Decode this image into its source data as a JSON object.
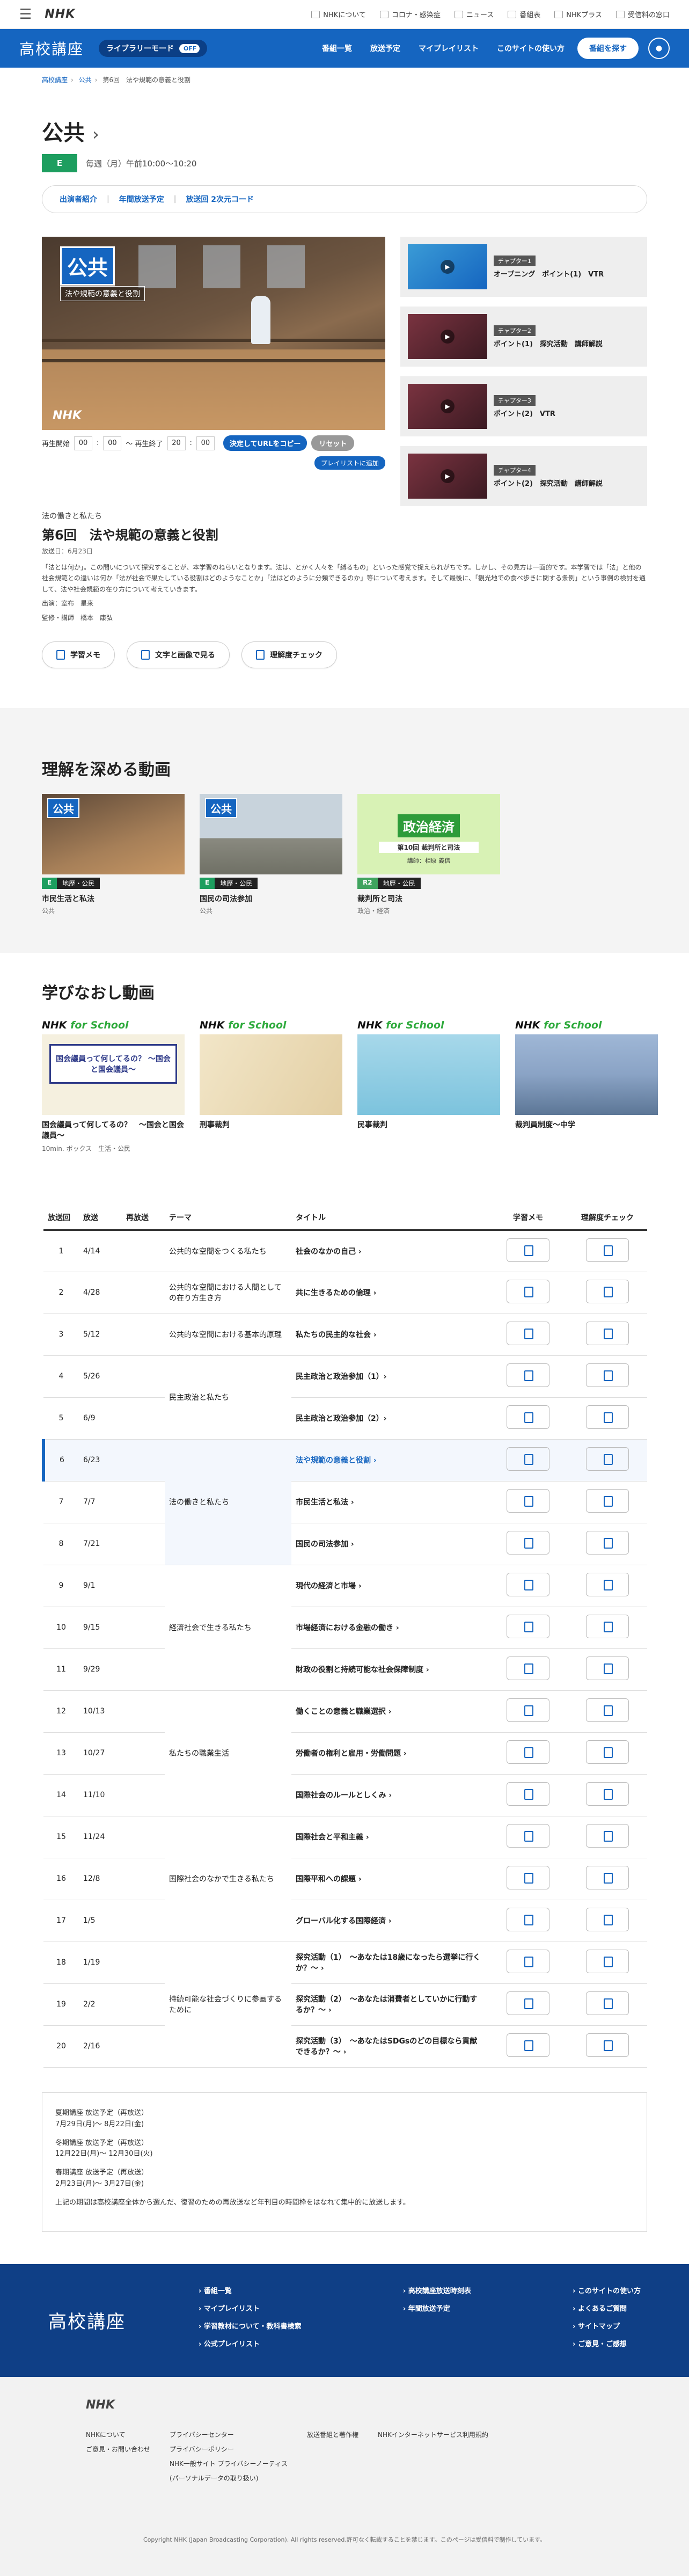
{
  "nhkbar": {
    "logo": "NHK",
    "links": [
      "NHKについて",
      "コロナ・感染症",
      "ニュース",
      "番組表",
      "NHKプラス",
      "受信料の窓口"
    ]
  },
  "header": {
    "brand": "高校講座",
    "lite_mode": "ライブラリーモード",
    "lite_state": "OFF",
    "nav": [
      "番組一覧",
      "放送予定",
      "マイプレイリスト",
      "このサイトの使い方"
    ],
    "search": "番組を探す"
  },
  "breadcrumb": [
    "高校講座",
    "公共",
    "第6回　法や規範の意義と役割"
  ],
  "program": {
    "title": "公共",
    "channel": "E",
    "airtime": "毎週（月）午前10:00〜10:20",
    "infobar": [
      "出演者紹介",
      "年間放送予定",
      "放送回 2次元コード"
    ]
  },
  "player": {
    "title_card": "公共",
    "caption": "法や規範の意義と役割",
    "watermark": "NHK",
    "start_label": "再生開始",
    "start_min": "00",
    "start_sec": "00",
    "end_label": "〜 再生終了",
    "end_min": "20",
    "end_sec": "00",
    "copy_btn": "決定してURLをコピー",
    "reset_btn": "リセット",
    "playlist_btn": "プレイリストに追加"
  },
  "chapters": [
    {
      "tag": "チャプター1",
      "title": "オープニング　ポイント(1)　VTR"
    },
    {
      "tag": "チャプター2",
      "title": "ポイント(1)　探究活動　講師解説"
    },
    {
      "tag": "チャプター3",
      "title": "ポイント(2)　VTR"
    },
    {
      "tag": "チャプター4",
      "title": "ポイント(2)　探究活動　講師解説"
    }
  ],
  "episode": {
    "series": "法の働きと私たち",
    "title": "第6回　法や規範の意義と役割",
    "date": "放送日：6月23日",
    "description": "「法とは何か」。この問いについて探究することが、本学習のねらいとなります。法は、とかく人々を「縛るもの」といった感覚で捉えられがちです。しかし、その見方は一面的です。本学習では「法」と他の社会規範との違いは何か「法が社会で果たしている役割はどのようなことか」「法はどのように分類できるのか」等について考えます。そして最後に、「観光地での食べ歩きに関する条例」という事例の検討を通して、法や社会規範の在り方について考えていきます。",
    "cast1": "出演：室布　星来",
    "cast2": "監修・講師　橋本　康弘"
  },
  "actions": [
    "学習メモ",
    "文字と画像で見る",
    "理解度チェック"
  ],
  "deepen": {
    "heading": "理解を深める動画",
    "cards": [
      {
        "card_title": "公共",
        "channel": "E",
        "category": "地歴・公民",
        "name": "市民生活と私法",
        "subject": "公共"
      },
      {
        "card_title": "公共",
        "channel": "E",
        "category": "地歴・公民",
        "name": "国民の司法参加",
        "subject": "公共"
      },
      {
        "card_title": "政治経済",
        "channel": "R2",
        "category": "地歴・公民",
        "name": "裁判所と司法",
        "subject": "政治・経済",
        "sub": "第10回 裁判所と司法",
        "lecturer": "講師：相原 義信"
      }
    ]
  },
  "relearn": {
    "heading": "学びなおし動画",
    "fs_prefix": "NHK ",
    "fs_suffix": "for School",
    "cards": [
      {
        "name": "国会議員って何してるの？　～国会と国会議員～",
        "q": "国会議員って何してるの？ ～国会と国会議員～",
        "meta": "10min. ボックス　生活・公民"
      },
      {
        "name": "刑事裁判",
        "meta": ""
      },
      {
        "name": "民事裁判",
        "meta": ""
      },
      {
        "name": "裁判員制度～中学",
        "meta": ""
      }
    ]
  },
  "schedule": {
    "headers": [
      "放送回",
      "放送",
      "再放送",
      "テーマ",
      "タイトル",
      "学習メモ",
      "理解度チェック"
    ],
    "rows": [
      {
        "num": "1",
        "date": "4/14",
        "title": "社会のなかの自己 ›"
      },
      {
        "num": "2",
        "date": "4/28",
        "title": "共に生きるための倫理 ›"
      },
      {
        "num": "3",
        "date": "5/12",
        "title": "私たちの民主的な社会 ›"
      },
      {
        "num": "4",
        "date": "5/26",
        "title": "民主政治と政治参加（1）›"
      },
      {
        "num": "5",
        "date": "6/9",
        "title": "民主政治と政治参加（2）›"
      },
      {
        "num": "6",
        "date": "6/23",
        "title": "法や規範の意義と役割 ›"
      },
      {
        "num": "7",
        "date": "7/7",
        "title": "市民生活と私法 ›"
      },
      {
        "num": "8",
        "date": "7/21",
        "title": "国民の司法参加 ›"
      },
      {
        "num": "9",
        "date": "9/1",
        "title": "現代の経済と市場 ›"
      },
      {
        "num": "10",
        "date": "9/15",
        "title": "市場経済における金融の働き ›"
      },
      {
        "num": "11",
        "date": "9/29",
        "title": "財政の役割と持続可能な社会保障制度 ›"
      },
      {
        "num": "12",
        "date": "10/13",
        "title": "働くことの意義と職業選択 ›"
      },
      {
        "num": "13",
        "date": "10/27",
        "title": "労働者の権利と雇用・労働問題 ›"
      },
      {
        "num": "14",
        "date": "11/10",
        "title": "国際社会のルールとしくみ ›"
      },
      {
        "num": "15",
        "date": "11/24",
        "title": "国際社会と平和主義 ›"
      },
      {
        "num": "16",
        "date": "12/8",
        "title": "国際平和への課題 ›"
      },
      {
        "num": "17",
        "date": "1/5",
        "title": "グローバル化する国際経済 ›"
      },
      {
        "num": "18",
        "date": "1/19",
        "title": "探究活動（1）　～あなたは18歳になったら選挙に行くか？～ ›"
      },
      {
        "num": "19",
        "date": "2/2",
        "title": "探究活動（2）　～あなたは消費者としていかに行動するか？～ ›"
      },
      {
        "num": "20",
        "date": "2/16",
        "title": "探究活動（3）　～あなたはSDGsのどの目標なら貢献できるか？～ ›"
      }
    ],
    "themes": [
      {
        "text": "公共的な空間をつくる私たち"
      },
      {
        "text": "公共的な空間における人間としての在り方生き方"
      },
      {
        "text": "公共的な空間における基本的原理"
      },
      {
        "text": "民主政治と私たち"
      },
      {
        "text": "法の働きと私たち"
      },
      {
        "text": "経済社会で生きる私たち"
      },
      {
        "text": "私たちの職業生活"
      },
      {
        "text": "国際社会のなかで生きる私たち"
      },
      {
        "text": "持続可能な社会づくりに参画するために"
      }
    ]
  },
  "notes": {
    "l1": "夏期講座 放送予定（再放送）",
    "l2": "7月29日(月)〜 8月22日(金)",
    "l3": "冬期講座 放送予定（再放送）",
    "l4": "12月22日(月)〜 12月30日(火)",
    "l5": "春期講座 放送予定（再放送）",
    "l6": "2月23日(月)〜 3月27日(金)",
    "l7": "上記の期間は高校講座全体から選んだ、復習のための再放送など年刊目の時間枠をはなれて集中的に放送します。"
  },
  "footer": {
    "brand": "高校講座",
    "col1": [
      "番組一覧",
      "マイプレイリスト",
      "学習教材について・教科書検索",
      "公式プレイリスト"
    ],
    "col2": [
      "高校講座放送時刻表",
      "年間放送予定"
    ],
    "col3": [
      "このサイトの使い方",
      "よくあるご質問",
      "サイトマップ",
      "ご意見・ご感想"
    ],
    "logo": "NHK",
    "g1": [
      "NHKについて",
      "ご意見・お問い合わせ"
    ],
    "g2": [
      "プライバシーセンター",
      "プライバシーポリシー",
      "NHK一般サイト プライバシーノーティス",
      "(パーソナルデータの取り扱い)"
    ],
    "g3": [
      "放送番組と著作権"
    ],
    "g4": [
      "NHKインターネットサービス利用規約"
    ],
    "copyright": "Copyright NHK (Japan Broadcasting Corporation). All rights reserved.許可なく転載することを禁じます。このページは受信料で制作しています。"
  }
}
